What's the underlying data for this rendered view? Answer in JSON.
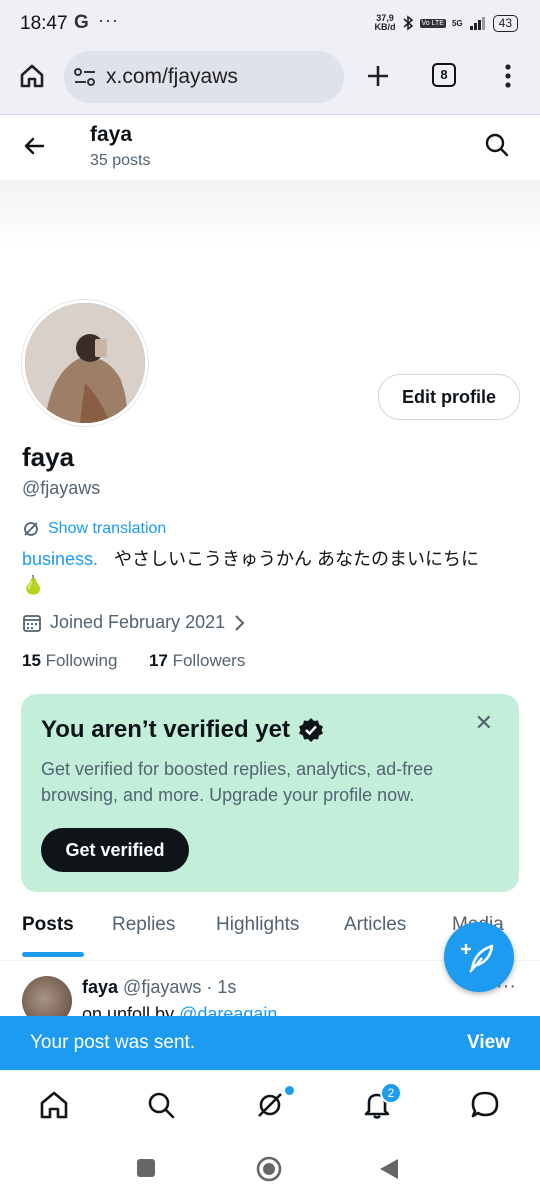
{
  "status_bar": {
    "time": "18:47",
    "g_glyph": "G",
    "dots": "···",
    "speed": "37,9",
    "speed_unit": "KB/d",
    "network": "5G",
    "volte": "Vo LTE",
    "battery": "43"
  },
  "browser": {
    "url": "x.com/fjayaws",
    "tab_count": "8"
  },
  "header": {
    "name": "faya",
    "post_count": "35 posts"
  },
  "profile": {
    "edit_label": "Edit profile",
    "name": "faya",
    "handle": "@fjayaws",
    "translate_label": "Show translation",
    "bio_link": "business.",
    "bio_text": "やさしいこうきゅうかん あなたのまいにちに",
    "bio_emoji": "🍐",
    "joined": "Joined February 2021",
    "following_count": "15",
    "following_label": "Following",
    "followers_count": "17",
    "followers_label": "Followers"
  },
  "verify_card": {
    "title": "You aren’t verified yet",
    "close": "✕",
    "description": "Get verified for boosted replies, analytics, ad-free browsing, and more. Upgrade your profile now.",
    "button": "Get verified"
  },
  "tabs": [
    "Posts",
    "Replies",
    "Highlights",
    "Articles",
    "Media"
  ],
  "post": {
    "name": "faya",
    "handle": "@fjayaws",
    "sep": "·",
    "time": "1s",
    "more": "···",
    "body_prefix": "on unfoll by ",
    "mention": "@dareagain"
  },
  "toast": {
    "message": "Your post was sent.",
    "action": "View"
  },
  "bottom_nav": {
    "notifications_badge": "2"
  },
  "colors": {
    "accent": "#1d9bf0",
    "card_bg": "#c3efda",
    "text_primary": "#0f1419",
    "text_secondary": "#536471"
  }
}
